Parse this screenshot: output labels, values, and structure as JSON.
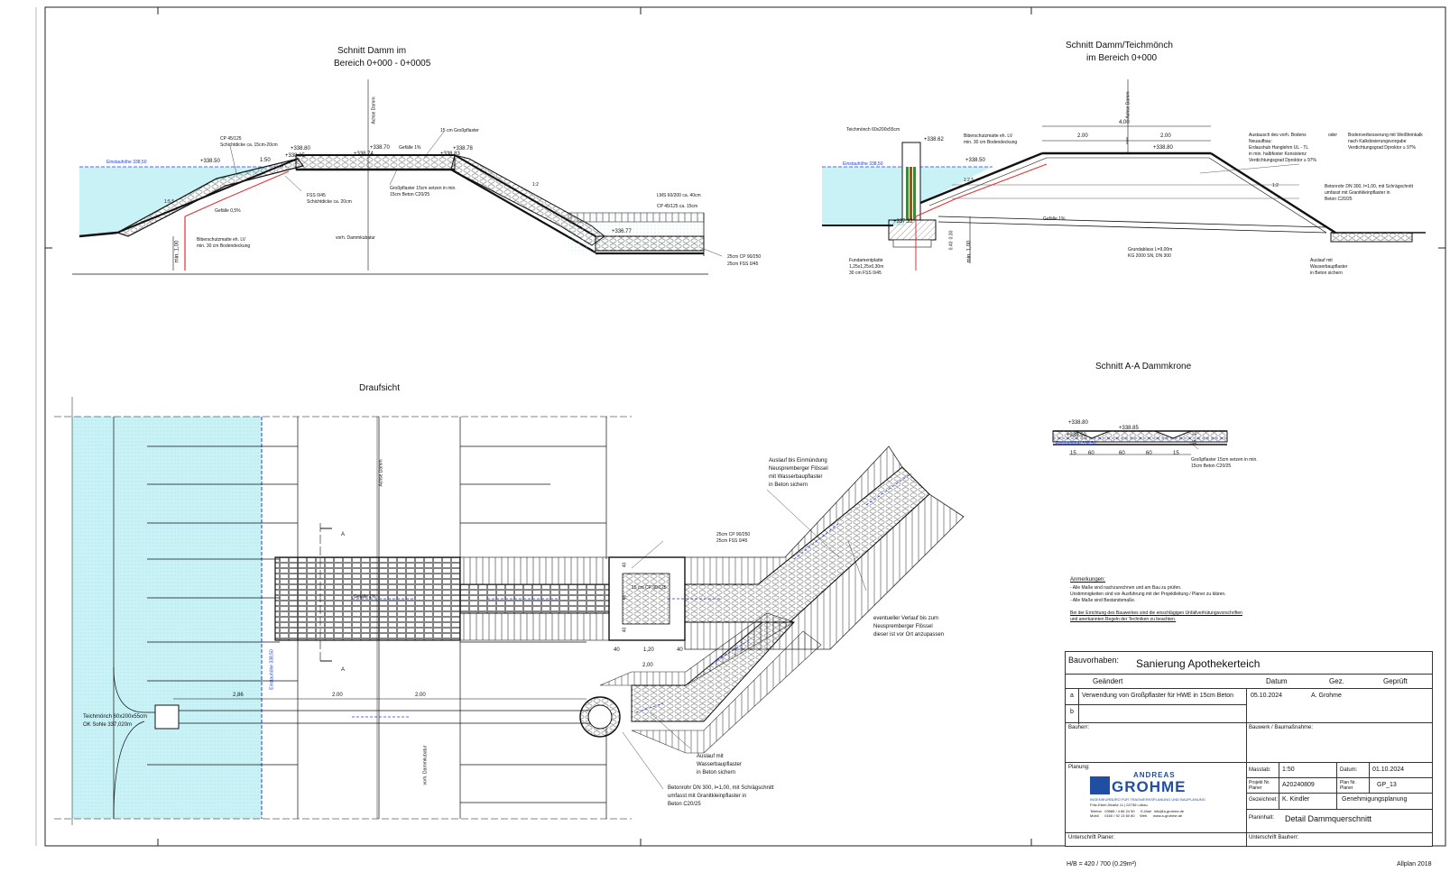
{
  "titles": {
    "section_left_1": "Schnitt Damm im",
    "section_left_2": "Bereich 0+000 - 0+0005",
    "section_right_1": "Schnitt Damm/Teichmönch",
    "section_right_2": "im Bereich 0+000",
    "plan_view": "Draufsicht",
    "crest_section": "Schnitt A-A  Dammkrone"
  },
  "left_section": {
    "levels": [
      "+338.50",
      "+338.80",
      "+338.85",
      "+338.74",
      "+338.70",
      "+338.78",
      "+338.83",
      "+336.77"
    ],
    "water_label": "Einstauhöhe 338,50",
    "axis_label": "Achse Damm",
    "slope_labels": [
      "1:5.5",
      "1:50",
      "1:2"
    ],
    "notes": [
      "CP 45/125",
      "Schichtdicke ca. 15cm-20cm",
      "15 cm Großpflaster",
      "Gefälle 1%",
      "Großpflaster 15cm  setzen in min.",
      "15cm Beton C20/25",
      "FSS 0/45",
      "Schichtdicke ca. 20cm",
      "Gefälle 0,5%",
      "Biberschutzmatte eh. LV",
      "min. 30 cm Bodendeckung",
      "vorh. Dammkubatur",
      "LMS 60/200 ca. 40cm",
      "CP 45/125 ca. 15cm",
      "25cm CP 90/250",
      "25cm FSS 0/45",
      "min. 1,00"
    ]
  },
  "right_section": {
    "levels": [
      "+338.62",
      "+338.50",
      "+338.80",
      "+337.32"
    ],
    "water_label": "Einstauhöhe 338,50",
    "axis_label": "Achse Damm",
    "dims": [
      "4,00",
      "2.00",
      "2.00",
      "min. 1,00",
      "0.30",
      "0.40"
    ],
    "slope_labels": [
      "1:2.5",
      "1:2"
    ],
    "notes": [
      "Teichmönch 60x200x55cm",
      "Biberschutzmatte eh. LV",
      "min. 30 cm Bodendeckung",
      "Austausch des vorh. Bodens",
      "Neuaufbau:",
      "Erdaushub Hanglehm UL - TL",
      "in min. halbfester Konsistenz",
      "Verdichtungsgrad Dproktor ≥ 97%",
      "oder",
      "Bodenverbesserung mit Weißfeinkalk",
      "nach Kalkdosierungsvorgabe",
      "Verdichtungsgrad Dproktor ≥ 97%",
      "Betonrohr DN 300, l=1,00, mit Schrägschnitt",
      "umfasst mit Granitkleinpflaster in",
      "Beton C20/25",
      "Gefälle 1%",
      "Grundablass L=9,00m",
      "KG 2000 SN, DN 300",
      "Fundamentplatte",
      "1,25x1,25x0,30m",
      "30 cm FSS 0/45",
      "Auslauf mit",
      "Wasserbaupflaster",
      "in Beton sichern"
    ]
  },
  "crest_section": {
    "levels": [
      "+338.80",
      "+338.85",
      "+338.50"
    ],
    "water_label": "Einstauhöhe 338,50",
    "dims": [
      "15",
      "60",
      "60",
      "60",
      "15",
      "10",
      "15"
    ],
    "notes": [
      "Großpflaster 15cm  setzen in min.",
      "15cm Beton C20/25"
    ]
  },
  "plan": {
    "dims": [
      "2,86",
      "2.00",
      "2.00",
      "40",
      "1,20",
      "40",
      "2,00",
      "40",
      "60",
      "40"
    ],
    "labels": {
      "monk": "Teichmönch 60x200x55cm",
      "monk_sole": "OK Sohle 337,020m",
      "axis": "Achse Damm",
      "footprint": "vorh. Dammkubatur",
      "water_edge": "Einstauhöhe 338,50",
      "section_marks": [
        "A",
        "A"
      ],
      "gefaelle": "Gefälle 1%",
      "cp": "15 cm CP 90/125",
      "layers": [
        "25cm CP 90/250",
        "25cm FSS 0/45"
      ],
      "outlet_top_1": "Auslauf bis Einmündung",
      "outlet_top_2": "Neuspremberger Flössel",
      "outlet_top_3": "mit Wasserbaupflaster",
      "outlet_top_4": "in Beton sichern",
      "route_1": "eventueller Verlauf bis zum",
      "route_2": "Neuspremberger Flössel",
      "route_3": "dieser ist vor Ort anzupassen",
      "outlet_bot_1": "Auslauf mit",
      "outlet_bot_2": "Wasserbaupflaster",
      "outlet_bot_3": "in Beton sichern",
      "pipe_1": "Betonrohr DN 300, l=1,00, mit Schrägschnitt",
      "pipe_2": "umfasst mit Granitkleinpflaster in",
      "pipe_3": "Beton C20/25"
    }
  },
  "remarks": {
    "heading": "Anmerkungen:",
    "lines": [
      "- Alle Maße sind nachzurechnen und am Bau zu prüfen.",
      "  Unstimmigkeiten sind vor Ausführung mit der Projektleitung / Planer zu klären.",
      "- Alle Maße sind Bestandsmaße.",
      "Bei der Errichtung des Bauwerkes sind die einschlägigen Unfallverhütungsvorschriften",
      "und anerkannten Regeln der Techniken zu beachten."
    ]
  },
  "title_block": {
    "project_label": "Bauvorhaben:",
    "project": "Sanierung Apothekerteich",
    "col_changed": "Geändert",
    "col_date": "Datum",
    "col_drawn": "Gez.",
    "col_checked": "Geprüft",
    "rev_a": "a",
    "rev_a_text": "Verwendung von Großpflaster für HWE in 15cm Beton",
    "rev_a_date": "05.10.2024",
    "rev_a_drawn": "A. Grohme",
    "rev_b": "b",
    "client_label": "Bauherr:",
    "structure_label": "Bauwerk / Baumaßnahme:",
    "planning_label": "Planung:",
    "logo_top": "ANDREAS",
    "logo_main": "GROHME",
    "logo_sub": "INGENIEURBÜRO FÜR TRAGWERKSPLANUNG UND BAUPLANUNG",
    "logo_addr": "Fritz-Eberl-Straße 11  |  02736 Löbau",
    "logo_contact_1": "Telefon   03585 / 4 86 24 50      E-Mail   info@a-grohme.de",
    "logo_contact_2": "Mobil      0160 / 92 13 60 80     Web      www.a-grohme.de",
    "scale_label": "Masstab:",
    "scale": "1:50",
    "date_label": "Datum:",
    "date": "01.10.2024",
    "projno_label_1": "Projekt Nr.",
    "projno_label_2": "Planer",
    "projno": "A20240809",
    "planno_label_1": "Plan Nr.",
    "planno_label_2": "Planer",
    "planno": "GP_13",
    "drawn_label": "Gezeichnet:",
    "drawn": "K. Kindler",
    "phase": "Genehmigungsplanung",
    "content_label": "Planinhalt:",
    "content": "Detail Dammquerschnitt",
    "sig_planner": "Unterschrift Planer:",
    "sig_client": "Unterschrift Bauherr:"
  },
  "footer": {
    "format": "H/B = 420 / 700 (0.29m²)",
    "software": "Allplan 2018"
  },
  "colors": {
    "water": "#c9f2f6",
    "water_line": "#2040e0",
    "liner": "#e03030",
    "ink": "#111111",
    "monk_green": "#3a8a3a",
    "monk_brown": "#8a5a2a",
    "logo_blue": "#1f4ea3"
  }
}
